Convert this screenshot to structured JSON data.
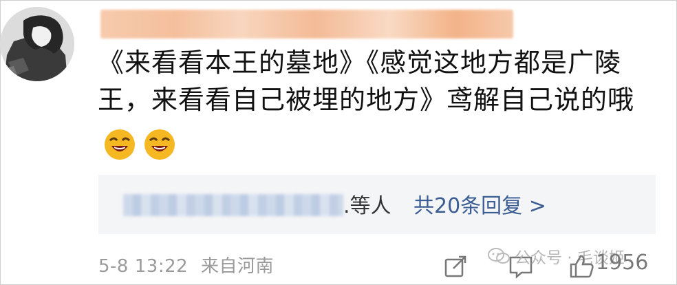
{
  "comment": {
    "text": "《来看看本王的墓地》《感觉这地方都是广陵王，来看看自己被埋的地方》鸢解自己说的哦",
    "emoji": [
      "laughing-emoji",
      "laughing-emoji"
    ]
  },
  "reply": {
    "suffix": ".等人",
    "count_label": "共20条回复 >"
  },
  "meta": {
    "timestamp": "5-8 13:22",
    "location": "来自河南"
  },
  "actions": {
    "like_count": "1956"
  },
  "watermark": {
    "text": "公众号 · 毛谈姬"
  },
  "colors": {
    "link": "#3b5d93",
    "meta_gray": "#9a9a9a",
    "reply_bg": "#f4f5f7"
  }
}
